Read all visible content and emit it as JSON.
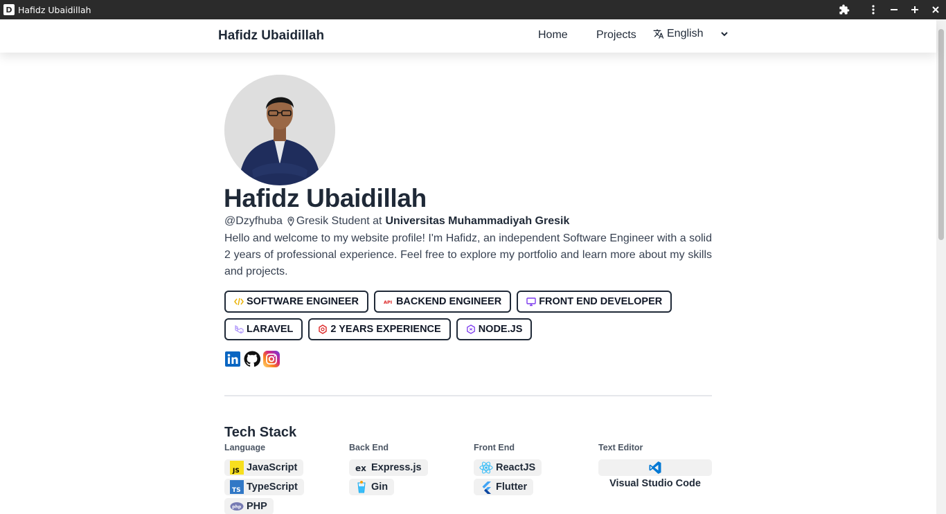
{
  "window": {
    "title": "Hafidz Ubaidillah",
    "app_icon_letter": "D",
    "controls": [
      "extensions-icon",
      "menu-icon",
      "minimize-icon",
      "maximize-icon",
      "close-icon"
    ]
  },
  "navbar": {
    "brand": "Hafidz Ubaidillah",
    "links": [
      {
        "label": "Home"
      },
      {
        "label": "Projects"
      }
    ],
    "language": {
      "selected": "English",
      "icon": "translate-icon"
    }
  },
  "profile": {
    "name": "Hafidz Ubaidillah",
    "username": "@Dzyfhuba",
    "location_text": "Gresik Student at",
    "institution": "Universitas Muhammadiyah Gresik",
    "bio": "Hello and welcome to my website profile! I'm Hafidz, an independent Software Engineer with a solid 2 years of professional experience. Feel free to explore my portfolio and learn more about my skills and projects."
  },
  "tags": [
    {
      "label": "SOFTWARE ENGINEER",
      "icon": "code-icon",
      "color": "#eab308"
    },
    {
      "label": "BACKEND ENGINEER",
      "icon": "api-icon",
      "color": "#dc2626"
    },
    {
      "label": "FRONT END DEVELOPER",
      "icon": "monitor-icon",
      "color": "#7c3aed"
    },
    {
      "label": "LARAVEL",
      "icon": "laravel-icon",
      "color": "#a78bfa"
    },
    {
      "label": "2 YEARS EXPERIENCE",
      "icon": "hexagon-icon",
      "color": "#dc2626"
    },
    {
      "label": "NODE.JS",
      "icon": "nodejs-icon",
      "color": "#7c3aed"
    }
  ],
  "socials": [
    {
      "name": "linkedin-icon",
      "color": "#0a66c2"
    },
    {
      "name": "github-icon",
      "color": "#111111"
    },
    {
      "name": "instagram-icon",
      "color": "#d62976"
    }
  ],
  "tech_stack": {
    "title": "Tech Stack",
    "language": {
      "heading": "Language",
      "items": [
        "JavaScript",
        "TypeScript",
        "PHP"
      ]
    },
    "back_end": {
      "heading": "Back End",
      "items": [
        "Express.js",
        "Gin"
      ]
    },
    "front_end": {
      "heading": "Front End",
      "items": [
        "ReactJS",
        "Flutter"
      ]
    },
    "text_editor": {
      "heading": "Text Editor",
      "items": [
        "Visual Studio Code"
      ]
    }
  }
}
